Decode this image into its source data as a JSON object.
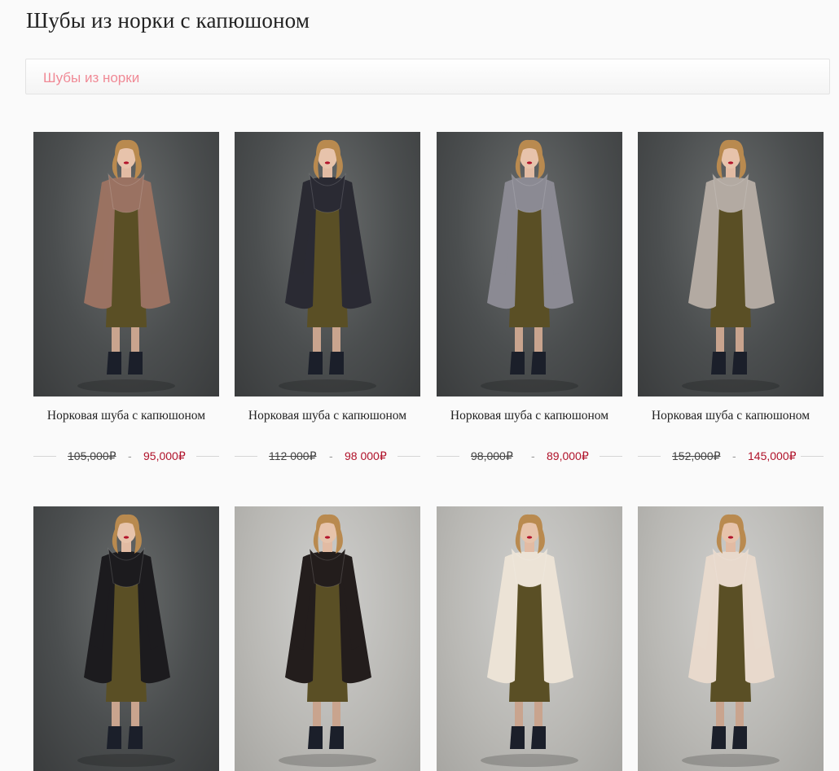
{
  "page": {
    "title": "Шубы из норки с капюшоном",
    "breadcrumb": "Шубы из норки"
  },
  "colors": {
    "accent": "#f08a96",
    "new_price": "#b0122a",
    "background": "#fafafa"
  },
  "products": [
    {
      "title": "Норковая шуба с капюшоном",
      "old_price": "105,000₽",
      "new_price": "95,000₽",
      "coat_color": "#9a7262",
      "backdrop": "studio"
    },
    {
      "title": "Норковая шуба с капюшоном",
      "old_price": "112 000₽",
      "new_price": "98 000₽",
      "coat_color": "#2a2a33",
      "backdrop": "studio"
    },
    {
      "title": "Норковая шуба с капюшоном",
      "old_price": "98,000₽",
      "new_price": "89,000₽",
      "coat_color": "#8b8a93",
      "backdrop": "studio"
    },
    {
      "title": "Норковая шуба с капюшоном",
      "old_price": "152,000₽",
      "new_price": "145,000₽",
      "coat_color": "#b3aaa2",
      "backdrop": "studio"
    },
    {
      "coat_color": "#1c1b1e",
      "backdrop": "studio"
    },
    {
      "coat_color": "#231d1c",
      "backdrop": "wall"
    },
    {
      "coat_color": "#ece3d6",
      "backdrop": "wall"
    },
    {
      "coat_color": "#e8d9cc",
      "backdrop": "wall"
    }
  ]
}
